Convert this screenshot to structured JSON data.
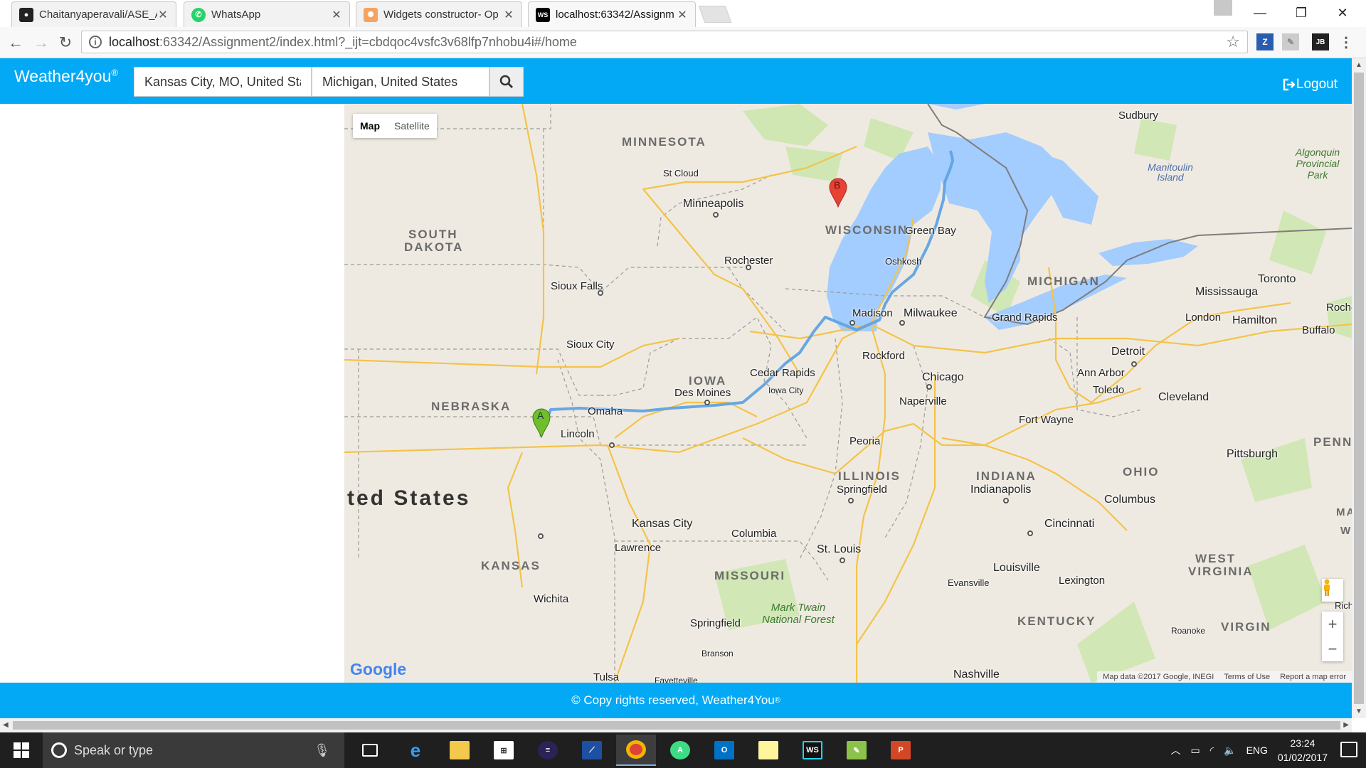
{
  "browser": {
    "tabs": [
      {
        "title": "Chaitanyaperavali/ASE_A",
        "icon": "github-icon",
        "active": false
      },
      {
        "title": "WhatsApp",
        "icon": "whatsapp-icon",
        "active": false
      },
      {
        "title": "Widgets constructor- Op",
        "icon": "widgets-icon",
        "active": false
      },
      {
        "title": "localhost:63342/Assignm",
        "icon": "webstorm-icon",
        "active": true
      }
    ],
    "url_host": "localhost",
    "url_rest": ":63342/Assignment2/index.html?_ijt=cbdqoc4vsfc3v68lfp7nhobu4i#/home"
  },
  "app": {
    "brand": "Weather4you",
    "brand_mark": "®",
    "source_value": "Kansas City, MO, United Sta",
    "destination_value": "Michigan, United States",
    "logout_label": "Logout",
    "footer_text": "© Copy rights reserved, Weather4You",
    "footer_mark": "®"
  },
  "map": {
    "type_buttons": {
      "map": "Map",
      "satellite": "Satellite"
    },
    "google_logo": "Google",
    "footer": {
      "data": "Map data ©2017 Google, INEGI",
      "terms": "Terms of Use",
      "report": "Report a map error"
    },
    "markers": {
      "start": "A",
      "end": "B"
    },
    "labels": {
      "minnesota": "MINNESOTA",
      "south_dakota_1": "SOUTH",
      "south_dakota_2": "DAKOTA",
      "wisconsin": "WISCONSIN",
      "michigan": "MICHIGAN",
      "iowa": "IOWA",
      "nebraska": "NEBRASKA",
      "illinois": "ILLINOIS",
      "indiana": "INDIANA",
      "ohio": "OHIO",
      "kansas": "KANSAS",
      "missouri": "MISSOURI",
      "kentucky": "KENTUCKY",
      "west_virginia_1": "WEST",
      "west_virginia_2": "VIRGINIA",
      "pennsylvania": "PENNSYI",
      "virginia": "VIRGIN",
      "united_states": "ted States",
      "sudbury": "Sudbury",
      "st_cloud": "St Cloud",
      "minneapolis": "Minneapolis",
      "rochester": "Rochester",
      "green_bay": "Green Bay",
      "oshkosh": "Oshkosh",
      "madison": "Madison",
      "milwaukee": "Milwaukee",
      "sioux_falls": "Sioux Falls",
      "sioux_city": "Sioux City",
      "rockford": "Rockford",
      "chicago": "Chicago",
      "naperville": "Naperville",
      "cedar_rapids": "Cedar Rapids",
      "iowa_city": "Iowa City",
      "des_moines": "Des Moines",
      "omaha": "Omaha",
      "lincoln": "Lincoln",
      "grand_rapids": "Grand Rapids",
      "detroit": "Detroit",
      "ann_arbor": "Ann Arbor",
      "toledo": "Toledo",
      "cleveland": "Cleveland",
      "toronto": "Toronto",
      "mississauga": "Mississauga",
      "london": "London",
      "hamilton": "Hamilton",
      "buffalo": "Buffalo",
      "roch": "Roche",
      "fort_wayne": "Fort Wayne",
      "peoria": "Peoria",
      "springfield_il": "Springfield",
      "indianapolis": "Indianapolis",
      "columbus": "Columbus",
      "pittsburgh": "Pittsburgh",
      "kansas_city": "Kansas City",
      "lawrence": "Lawrence",
      "columbia": "Columbia",
      "st_louis": "St. Louis",
      "cincinnati": "Cincinnati",
      "louisville": "Louisville",
      "lexington": "Lexington",
      "evansville": "Evansville",
      "wichita": "Wichita",
      "springfield_mo": "Springfield",
      "branson": "Branson",
      "tulsa": "Tulsa",
      "fayetteville": "Fayetteville",
      "nashville": "Nashville",
      "roanoke": "Roanoke",
      "rich": "Rich",
      "ma": "MA",
      "w": "W",
      "manitoulin": "Manitoulin Island",
      "algonquin": "Algonquin Provincial Park",
      "mark_twain": "Mark Twain National Forest"
    }
  },
  "taskbar": {
    "search_placeholder": "Speak or type",
    "language": "ENG",
    "time": "23:24",
    "date": "01/02/2017"
  },
  "colors": {
    "app_blue": "#03a9f4",
    "route": "#5fa3e3",
    "water": "#a3ccff",
    "marker_a": "#6fbf2c",
    "marker_b": "#e84235"
  }
}
